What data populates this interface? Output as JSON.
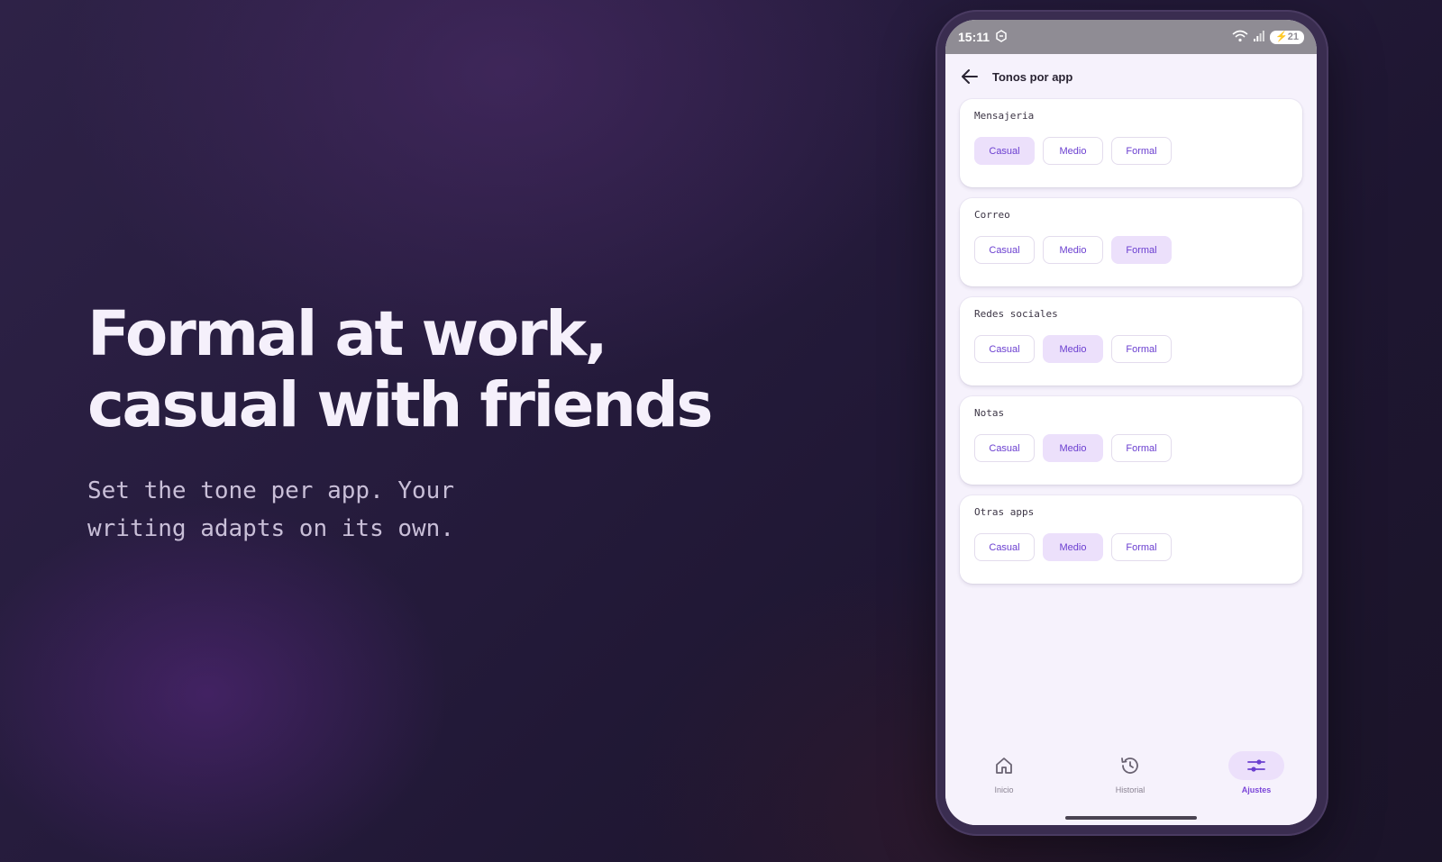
{
  "hero": {
    "title_line1": "Formal at work,",
    "title_line2": "casual with friends",
    "subtitle": "Set the tone per app. Your writing adapts on its own."
  },
  "status_bar": {
    "time": "15:11",
    "battery": "21"
  },
  "app_bar": {
    "title": "Tonos por app"
  },
  "tone_options": [
    "Casual",
    "Medio",
    "Formal"
  ],
  "apps": [
    {
      "label": "Mensajeria",
      "selected": "Casual"
    },
    {
      "label": "Correo",
      "selected": "Formal"
    },
    {
      "label": "Redes sociales",
      "selected": "Medio"
    },
    {
      "label": "Notas",
      "selected": "Medio"
    },
    {
      "label": "Otras apps",
      "selected": "Medio"
    }
  ],
  "bottom_nav": {
    "items": [
      {
        "label": "Inicio",
        "icon": "home-icon",
        "active": false
      },
      {
        "label": "Historial",
        "icon": "history-icon",
        "active": false
      },
      {
        "label": "Ajustes",
        "icon": "sliders-icon",
        "active": true
      }
    ]
  },
  "colors": {
    "accent": "#6b3fd0",
    "chip_selected_bg": "#ece0fb",
    "screen_bg": "#f6f2fc",
    "status_bar_bg": "#8f8c94"
  }
}
